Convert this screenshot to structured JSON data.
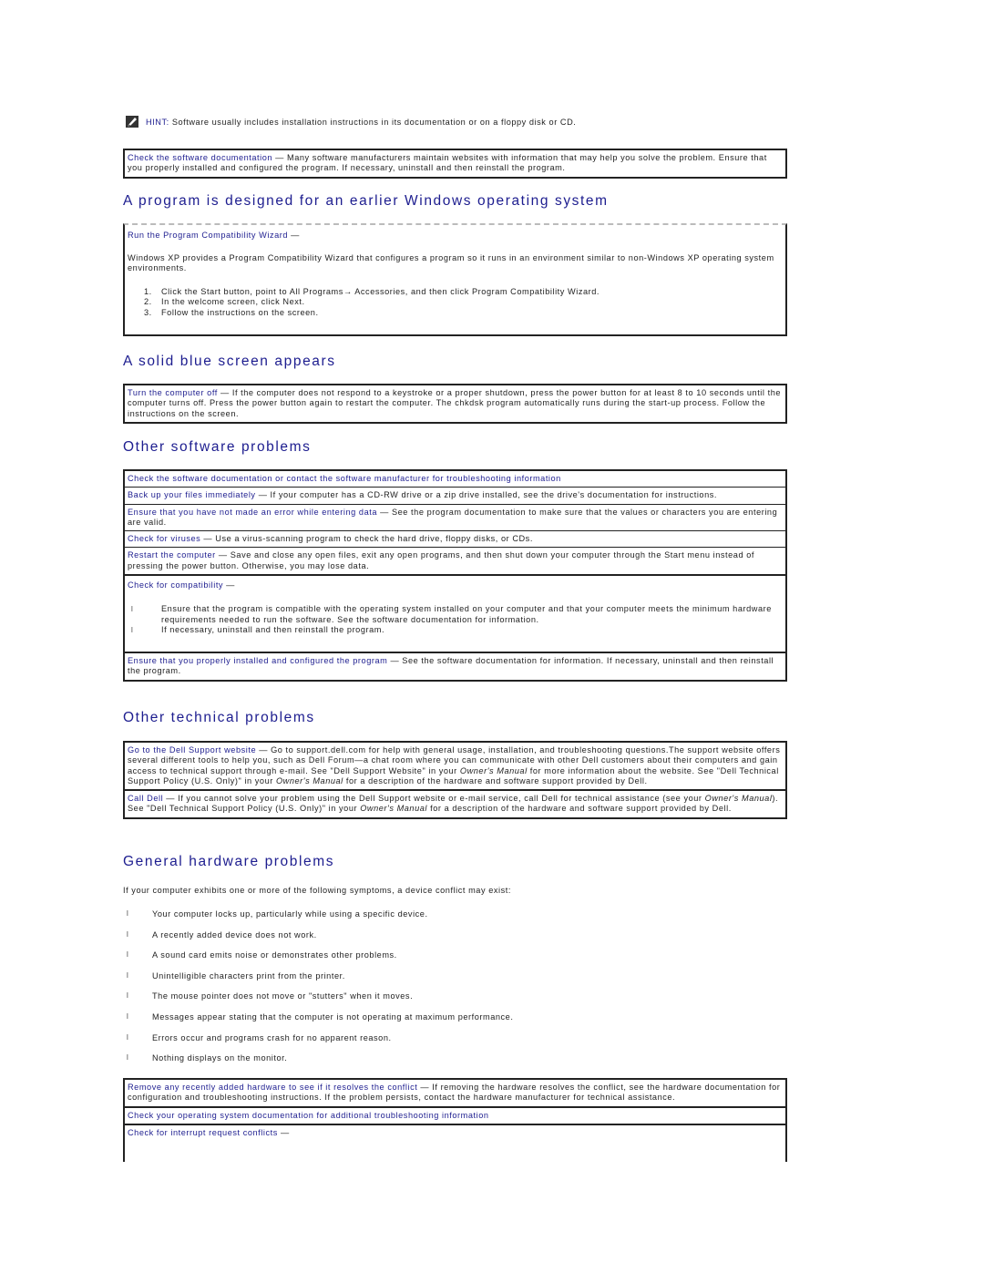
{
  "hint": {
    "icon": "pencil-note-icon",
    "label": "HINT:",
    "text": " Software usually includes installation instructions in its documentation or on a floppy disk or CD."
  },
  "intro_box": {
    "link": "Check the software documentation",
    "dash": " — ",
    "text": "Many software manufacturers maintain websites with information that may help you solve the problem. Ensure that you properly installed and configured the program. If necessary, uninstall and then reinstall the program."
  },
  "sections": {
    "earlier_windows": {
      "heading": "A program is designed for an earlier Windows operating system",
      "link": "Run the Program Compatibility Wizard",
      "dash": " —",
      "paragraph": "Windows XP provides a Program Compatibility Wizard that configures a program so it runs in an environment similar to non-Windows XP operating system environments.",
      "steps": [
        {
          "num": "1.",
          "text": "Click the Start button, point to All Programs→ Accessories, and then click Program Compatibility Wizard."
        },
        {
          "num": "2.",
          "text": "In the welcome screen, click Next."
        },
        {
          "num": "3.",
          "text": "Follow the instructions on the screen."
        }
      ]
    },
    "blue_screen": {
      "heading": "A solid blue screen appears",
      "link": "Turn the computer off",
      "dash": " — ",
      "text": "If the computer does not respond to a keystroke or a proper shutdown, press the power button for at least 8 to 10 seconds until the computer turns off. Press the power button again to restart the computer. The chkdsk program automatically runs during the start-up process. Follow the instructions on the screen."
    },
    "other_software": {
      "heading": "Other software problems",
      "rows": [
        {
          "link": "Check the software documentation or contact the software manufacturer for troubleshooting information",
          "dash": "",
          "text": ""
        },
        {
          "link": "Back up your files immediately",
          "dash": " — ",
          "text": "If your computer has a CD-RW drive or a zip drive installed, see the drive's documentation for instructions."
        },
        {
          "link": "Ensure that you have not made an error while entering data",
          "dash": " — ",
          "text": "See the program documentation to make sure that the values or characters you are entering are valid."
        },
        {
          "link": "Check for viruses",
          "dash": " — ",
          "text": "Use a virus-scanning program to check the hard drive, floppy disks, or CDs."
        },
        {
          "link": "Restart the computer",
          "dash": " — ",
          "text": "Save and close any open files, exit any open programs, and then shut down your computer through the Start menu instead of pressing the power button. Otherwise, you may lose data."
        }
      ],
      "compat": {
        "link": "Check for compatibility",
        "dash": " —",
        "bullet": "l",
        "items": [
          "Ensure that the program is compatible with the operating system installed on your computer and that your computer meets the minimum hardware requirements needed to run the software. See the software documentation for information.",
          "If necessary, uninstall and then reinstall the program."
        ]
      },
      "last": {
        "link": "Ensure that you properly installed and configured the program",
        "dash": " — ",
        "text": "See the software documentation for information. If necessary, uninstall and then reinstall the program."
      }
    },
    "other_technical": {
      "heading": "Other technical problems",
      "support": {
        "link": "Go to the Dell Support website",
        "dash": " — ",
        "text1": "Go to support.dell.com for help with general usage, installation, and troubleshooting questions.The support website offers several different tools to help you, such as Dell Forum—a chat room where you can communicate with other Dell customers about their computers and gain access to technical support through e-mail. See \"Dell Support Website\" in your ",
        "em1": "Owner's Manual",
        "text2": " for more information about the website. See \"Dell Technical Support Policy (U.S. Only)\" in your ",
        "em2": "Owner's Manual",
        "text3": " for a description of the hardware and software support provided by Dell."
      },
      "call": {
        "link": "Call Dell",
        "dash": " — ",
        "text1": "If you cannot solve your problem using the Dell Support website or e-mail service, call Dell for technical assistance (see your ",
        "em1": "Owner's Manual",
        "text2": "). See \"Dell Technical Support Policy (U.S. Only)\" in your ",
        "em2": "Owner's Manual",
        "text3": " for a description of the hardware and software support provided by Dell."
      }
    },
    "general_hardware": {
      "heading": "General hardware problems",
      "intro": "If your computer exhibits one or more of the following symptoms, a device conflict may exist:",
      "bullet": "l",
      "symptoms": [
        "Your computer locks up, particularly while using a specific device.",
        "A recently added device does not work.",
        "A sound card emits noise or demonstrates other problems.",
        "Unintelligible characters print from the printer.",
        "The mouse pointer does not move or \"stutters\" when it moves.",
        "Messages appear stating that the computer is not operating at maximum performance.",
        "Errors occur and programs crash for no apparent reason.",
        "Nothing displays on the monitor."
      ],
      "rows": [
        {
          "link": "Remove any recently added hardware to see if it resolves the conflict",
          "dash": " — ",
          "text": "If removing the hardware resolves the conflict, see the hardware documentation for configuration and troubleshooting instructions. If the problem persists, contact the hardware manufacturer for technical assistance."
        },
        {
          "link": "Check your operating system documentation for additional troubleshooting information",
          "dash": "",
          "text": ""
        },
        {
          "link": "Check for interrupt request conflicts",
          "dash": " —",
          "text": ""
        }
      ]
    }
  }
}
